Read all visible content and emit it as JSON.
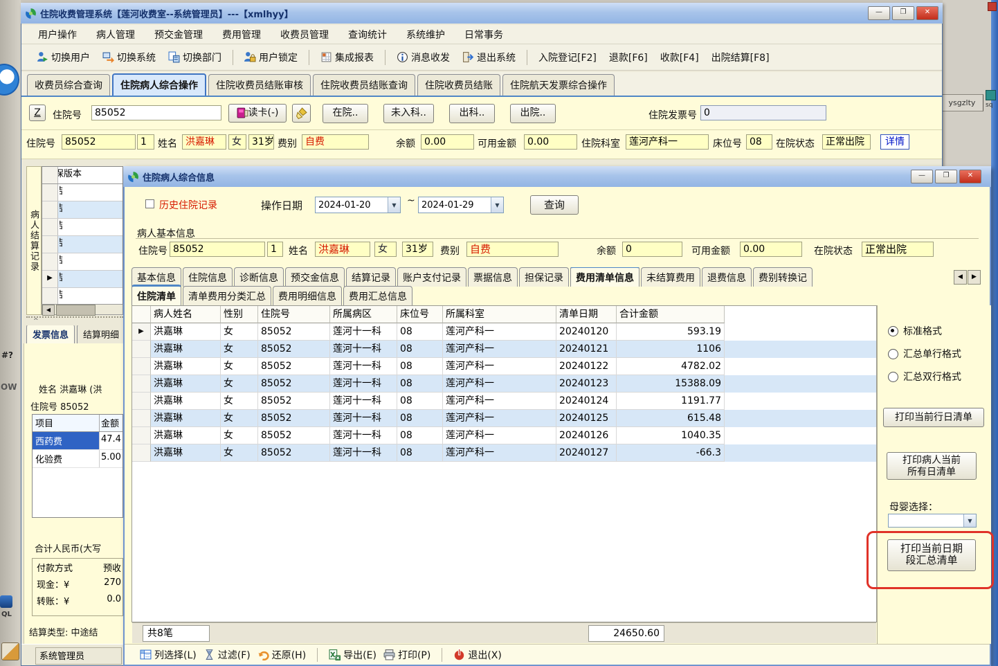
{
  "desktop": {
    "right_button_label": "ysgzlty",
    "right_icon_label": "sq",
    "left_label_1": "#?",
    "left_label_2": "OW",
    "left_label_3": "QL"
  },
  "glyphs": {
    "dropdown": "▼",
    "scroll_left": "◀",
    "scroll_right": "▶",
    "row_marker": "▶",
    "splitter": "^",
    "minimize": "—",
    "maximize": "❐",
    "close": "✕",
    "range_separator": "~"
  },
  "window": {
    "title": "住院收费管理系统【莲河收费室--系统管理员】---【xmlhyy】",
    "menu": [
      "用户操作",
      "病人管理",
      "预交金管理",
      "费用管理",
      "收费员管理",
      "查询统计",
      "系统维护",
      "日常事务"
    ],
    "toolbar": [
      {
        "label": "切换用户",
        "icon": "switch-user"
      },
      {
        "label": "切换系统",
        "icon": "switch-system"
      },
      {
        "label": "切换部门",
        "icon": "switch-department"
      },
      {
        "label": "用户锁定",
        "icon": "user-lock"
      },
      {
        "label": "集成报表",
        "icon": "integrated-report"
      },
      {
        "label": "消息收发",
        "icon": "messages"
      },
      {
        "label": "退出系统",
        "icon": "exit-system"
      }
    ],
    "toolbar_shortcuts": [
      "入院登记[F2]",
      "退款[F6]",
      "收款[F4]",
      "出院结算[F8]"
    ],
    "tabs": [
      "收费员综合查询",
      "住院病人综合操作",
      "住院收费员结账审核",
      "住院收费员结账查询",
      "住院收费员结账",
      "住院航天发票综合操作"
    ],
    "active_tab": 1
  },
  "search_row": {
    "z_button": "Z",
    "admission_label": "住院号",
    "admission_value": "85052",
    "read_card": "读卡(-)",
    "status_buttons": [
      "在院..",
      "未入科..",
      "出科..",
      "出院.."
    ],
    "invoice_label": "住院发票号",
    "invoice_value": "0"
  },
  "patient_bar": {
    "admission_label": "住院号",
    "admission_value": "85052",
    "seq": "1",
    "name_label": "姓名",
    "name": "洪嘉琳",
    "gender": "女",
    "age": "31岁",
    "fee_label": "费别",
    "fee_type": "自费",
    "balance_label": "余额",
    "balance": "0.00",
    "available_label": "可用金额",
    "available": "0.00",
    "dept_label": "住院科室",
    "dept": "莲河产科一",
    "bed_label": "床位号",
    "bed": "08",
    "status_label": "在院状态",
    "status": "正常出院",
    "detail_button": "详情"
  },
  "left_panel": {
    "vertical_label": "病人结算记录",
    "grid_header": "保版本",
    "grid_cell_fragment": "结",
    "grid_row_count": 7,
    "marker_row": 5,
    "tabs": [
      "发票信息",
      "结算明细"
    ],
    "name_label": "姓名",
    "name_value": "洪嘉琳 (洪",
    "admission_line": "住院号 85052",
    "item_headers": [
      "项目",
      "金额"
    ],
    "items": [
      {
        "name": "西药费",
        "amount": "47.4",
        "selected": true
      },
      {
        "name": "化验费",
        "amount": "5.00",
        "selected": false
      }
    ],
    "total_caption": "合计人民币(大写",
    "payment_rows": [
      {
        "label": "付款方式",
        "value": "预收"
      },
      {
        "label": "现金：¥",
        "value": "270"
      },
      {
        "label": "转账：¥",
        "value": "0.0"
      }
    ],
    "settle_type": "结算类型: 中途结",
    "statusbar": "系统管理员"
  },
  "dialog": {
    "title": "住院病人综合信息",
    "history_checkbox": "历史住院记录",
    "date_label": "操作日期",
    "date_from": "2024-01-20",
    "date_to": "2024-01-29",
    "query_button": "查询",
    "groupbox_title": "病人基本信息",
    "patient": {
      "admission_label": "住院号",
      "admission_value": "85052",
      "seq": "1",
      "name_label": "姓名",
      "name": "洪嘉琳",
      "gender": "女",
      "age": "31岁",
      "fee_label": "费别",
      "fee_type": "自费",
      "balance_label": "余额",
      "balance": "0",
      "available_label": "可用金额",
      "available": "0.00",
      "status_label": "在院状态",
      "status": "正常出院"
    },
    "tabs_primary": [
      "基本信息",
      "住院信息",
      "诊断信息",
      "预交金信息",
      "结算记录",
      "账户支付记录",
      "票据信息",
      "担保记录",
      "费用清单信息",
      "未结算费用",
      "退费信息",
      "费别转换记"
    ],
    "active_primary": 8,
    "tabs_secondary": [
      "住院清单",
      "清单费用分类汇总",
      "费用明细信息",
      "费用汇总信息"
    ],
    "active_secondary": 0,
    "table": {
      "headers": [
        "病人姓名",
        "性别",
        "住院号",
        "所属病区",
        "床位号",
        "所属科室",
        "清单日期",
        "合计金额"
      ],
      "rows": [
        [
          "洪嘉琳",
          "女",
          "85052",
          "莲河十一科",
          "08",
          "莲河产科一",
          "20240120",
          "593.19"
        ],
        [
          "洪嘉琳",
          "女",
          "85052",
          "莲河十一科",
          "08",
          "莲河产科一",
          "20240121",
          "1106"
        ],
        [
          "洪嘉琳",
          "女",
          "85052",
          "莲河十一科",
          "08",
          "莲河产科一",
          "20240122",
          "4782.02"
        ],
        [
          "洪嘉琳",
          "女",
          "85052",
          "莲河十一科",
          "08",
          "莲河产科一",
          "20240123",
          "15388.09"
        ],
        [
          "洪嘉琳",
          "女",
          "85052",
          "莲河十一科",
          "08",
          "莲河产科一",
          "20240124",
          "1191.77"
        ],
        [
          "洪嘉琳",
          "女",
          "85052",
          "莲河十一科",
          "08",
          "莲河产科一",
          "20240125",
          "615.48"
        ],
        [
          "洪嘉琳",
          "女",
          "85052",
          "莲河十一科",
          "08",
          "莲河产科一",
          "20240126",
          "1040.35"
        ],
        [
          "洪嘉琳",
          "女",
          "85052",
          "莲河十一科",
          "08",
          "莲河产科一",
          "20240127",
          "-66.3"
        ]
      ]
    },
    "footer_count": "共8笔",
    "footer_total": "24650.60",
    "right_panel": {
      "radios": [
        "标准格式",
        "汇总单行格式",
        "汇总双行格式"
      ],
      "selected_radio": 0,
      "print_current_row": "打印当前行日清单",
      "print_all_days_line1": "打印病人当前",
      "print_all_days_line2": "所有日清单",
      "mother_baby_label": "母婴选择：",
      "mother_baby_value": "",
      "print_range_line1": "打印当前日期",
      "print_range_line2": "段汇总清单"
    },
    "bottom_toolbar": [
      {
        "label": "列选择(L)",
        "icon": "column-select"
      },
      {
        "label": "过滤(F)",
        "icon": "filter"
      },
      {
        "label": "还原(H)",
        "icon": "restore"
      },
      {
        "label": "导出(E)",
        "icon": "export-excel"
      },
      {
        "label": "打印(P)",
        "icon": "printer"
      },
      {
        "label": "退出(X)",
        "icon": "power"
      }
    ]
  },
  "colors": {
    "accent_blue": "#4f86c6",
    "panel_yellow": "#fffcd9",
    "field_yellow": "#ffffc4",
    "alt_row_blue": "#d7e7f7",
    "alert_red": "#e03228",
    "value_red": "#d61a00",
    "link_blue": "#0014c8"
  }
}
